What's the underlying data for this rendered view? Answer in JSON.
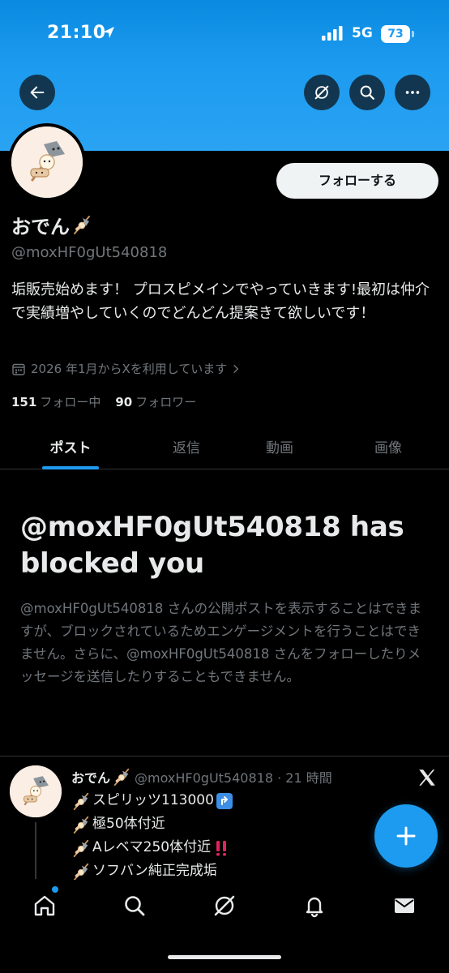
{
  "status_bar": {
    "time": "21:10",
    "network": "5G",
    "battery": "73"
  },
  "header": {
    "back_icon": "arrow-left-icon",
    "grok_icon": "grok-icon",
    "search_icon": "search-icon",
    "more_icon": "more-horizontal-icon",
    "banner_color": "#1d9bf0"
  },
  "profile": {
    "name": "おでん",
    "handle": "@moxHF0gUt540818",
    "follow_label": "フォローする",
    "bio": "垢販売始めます！ プロスピメインでやっていきます!最初は仲介で実績増やしていくのでどんどん提案きて欲しいです！",
    "joined": "2026 年1月からXを利用しています",
    "following_count": "151",
    "following_label": "フォロー中",
    "followers_count": "90",
    "followers_label": "フォロワー"
  },
  "tabs": [
    {
      "label": "ポスト",
      "active": true
    },
    {
      "label": "返信",
      "active": false
    },
    {
      "label": "動画",
      "active": false
    },
    {
      "label": "画像",
      "active": false
    }
  ],
  "blocked": {
    "title": "@moxHF0gUt540818 has blocked you",
    "message": "@moxHF0gUt540818 さんの公開ポストを表示することはできますが、ブロックされているためエンゲージメントを行うことはできません。さらに、@moxHF0gUt540818 さんをフォローしたりメッセージを送信したりすることもできません。"
  },
  "post": {
    "name": "おでん",
    "meta": "@moxHF0gUt540818 · 21 時間",
    "lines": [
      "スピリッツ113000",
      "極50体付近",
      "Aレベマ250体付近",
      "ソフバン純正完成垢"
    ]
  },
  "bottom_nav": [
    {
      "icon": "home-icon"
    },
    {
      "icon": "search-icon"
    },
    {
      "icon": "grok-icon"
    },
    {
      "icon": "bell-icon"
    },
    {
      "icon": "mail-icon"
    }
  ],
  "accent": "#1d9bf0"
}
